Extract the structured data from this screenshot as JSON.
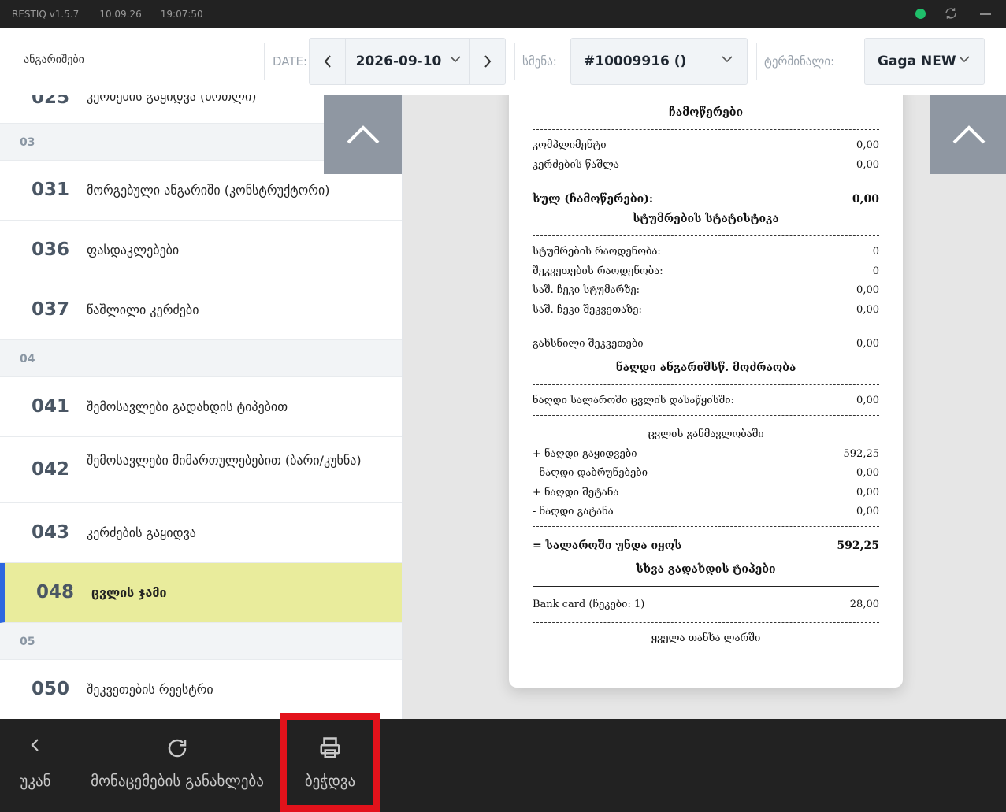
{
  "titlebar": {
    "app": "RESTIQ v1.5.7",
    "date": "10.09.26",
    "time": "19:07:50",
    "status_color": "#1fbf6a"
  },
  "toolbar": {
    "title": "ანგარიშები",
    "date_label": "DATE:",
    "date_value": "2026-09-10",
    "shift_label": "სმენა:",
    "shift_value": "#10009916 ()",
    "terminal_label": "ტერმინალი:",
    "terminal_value": "Gaga NEW"
  },
  "list": {
    "top_partial": {
      "code": "025",
      "label": "კერძების გაყიდვა (ბოთლი)"
    },
    "groups": [
      "03",
      "04",
      "05"
    ],
    "items": [
      {
        "code": "031",
        "label": "მორგებული ანგარიში (კონსტრუქტორი)"
      },
      {
        "code": "036",
        "label": "ფასდაკლებები"
      },
      {
        "code": "037",
        "label": "წაშლილი კერძები"
      },
      {
        "code": "041",
        "label": "შემოსავლები გადახდის ტიპებით"
      },
      {
        "code": "042",
        "label": "შემოსავლები მიმართულებებით (ბარი/კუხნა)"
      },
      {
        "code": "043",
        "label": "კერძების გაყიდვა"
      },
      {
        "code": "048",
        "label": "ცვლის ჯამი",
        "selected": true
      },
      {
        "code": "050",
        "label": "შეკვეთების რეესტრი"
      }
    ]
  },
  "receipt": {
    "sec_writeoffs": "ჩამოწერები",
    "compliment": {
      "label": "კომპლიმენტი",
      "value": "0,00"
    },
    "dish_delete": {
      "label": "კერძების წაშლა",
      "value": "0,00"
    },
    "total_writeoffs": {
      "label": "სულ (ჩამოწერები):",
      "value": "0,00"
    },
    "sec_guests": "სტუმრების სტატისტიკა",
    "guests_count": {
      "label": "სტუმრების რაოდენობა:",
      "value": "0"
    },
    "orders_count": {
      "label": "შეკვეთების რაოდენობა:",
      "value": "0"
    },
    "avg_guest": {
      "label": "საშ. ჩეკი სტუმარზე:",
      "value": "0,00"
    },
    "avg_order": {
      "label": "საშ. ჩეკი შეკვეთაზე:",
      "value": "0,00"
    },
    "open_orders": {
      "label": "გახსნილი შეკვეთები",
      "value": "0,00"
    },
    "sec_cash": "ნაღდი ანგარიშსწ. მოძრაობა",
    "cash_start": {
      "label": "ნაღდი სალაროში ცვლის დასაწყისში:",
      "value": "0,00"
    },
    "during_shift": "ცვლის განმავლობაში",
    "cash_sales": {
      "label": "+ ნაღდი გაყიდვები",
      "value": "592,25"
    },
    "cash_returns": {
      "label": "- ნაღდი დაბრუნებები",
      "value": "0,00"
    },
    "cash_in": {
      "label": "+ ნაღდი შეტანა",
      "value": "0,00"
    },
    "cash_out": {
      "label": "- ნაღდი გატანა",
      "value": "0,00"
    },
    "cash_should": {
      "label": "= სალაროში უნდა იყოს",
      "value": "592,25"
    },
    "sec_other": "სხვა გადახდის ტიპები",
    "bank_card": {
      "label": "Bank card (ჩეკები: 1)",
      "value": "28,00"
    },
    "footer": "ყველა თანხა ლარში"
  },
  "bottombar": {
    "back": "უკან",
    "refresh": "მონაცემების განახლება",
    "print": "ბეჭდვა"
  }
}
